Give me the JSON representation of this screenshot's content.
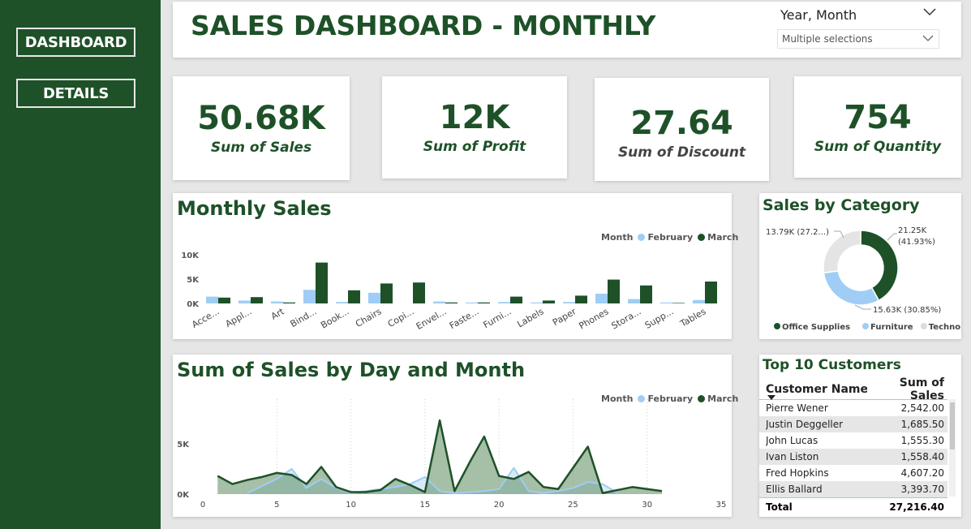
{
  "nav": {
    "dashboard": "DASHBOARD",
    "details": "DETAILS"
  },
  "header": {
    "title": "SALES DASHBOARD - MONTHLY",
    "slicer_label": "Year, Month",
    "slicer_value": "Multiple selections"
  },
  "kpis": [
    {
      "value": "50.68K",
      "label": "Sum of Sales"
    },
    {
      "value": "12K",
      "label": "Sum of Profit"
    },
    {
      "value": "27.64",
      "label": "Sum of Discount"
    },
    {
      "value": "754",
      "label": "Sum of Quantity"
    }
  ],
  "colors": {
    "brand": "#1e5128",
    "february": "#9fcdf5",
    "march": "#1e5128",
    "technology": "#e4e4e4"
  },
  "table": {
    "title": "Top 10 Customers",
    "headers": [
      "Customer Name",
      "Sum of Sales"
    ],
    "rows": [
      [
        "Pierre Wener",
        "2,542.00"
      ],
      [
        "Justin Deggeller",
        "1,685.50"
      ],
      [
        "John Lucas",
        "1,555.30"
      ],
      [
        "Ivan Liston",
        "1,558.40"
      ],
      [
        "Fred Hopkins",
        "4,607.20"
      ],
      [
        "Ellis Ballard",
        "3,393.70"
      ]
    ],
    "total_label": "Total",
    "total_value": "27,216.40"
  },
  "chart_data": [
    {
      "type": "bar",
      "title": "Monthly Sales",
      "legend_title": "Month",
      "categories": [
        "Acce...",
        "Appl...",
        "Art",
        "Bind...",
        "Book...",
        "Chairs",
        "Copi...",
        "Envel...",
        "Faste...",
        "Furni...",
        "Labels",
        "Paper",
        "Phones",
        "Stora...",
        "Supp...",
        "Tables"
      ],
      "series": [
        {
          "name": "February",
          "values": [
            1400,
            600,
            400,
            2800,
            300,
            2200,
            0,
            400,
            200,
            300,
            200,
            300,
            2000,
            900,
            200,
            700
          ]
        },
        {
          "name": "March",
          "values": [
            1200,
            1300,
            200,
            8400,
            2700,
            4100,
            4300,
            200,
            200,
            1400,
            600,
            1600,
            4900,
            3700,
            100,
            4500
          ]
        }
      ],
      "yticks": [
        "10K",
        "5K",
        "0K"
      ],
      "ylim": [
        0,
        10000
      ],
      "legend": "top-right"
    },
    {
      "type": "pie",
      "title": "Sales by Category",
      "labels": [
        "Office Supplies",
        "Furniture",
        "Technology"
      ],
      "values": [
        21.25,
        15.63,
        13.79
      ],
      "data_labels": [
        "21.25K (41.93%)",
        "15.63K (30.85%)",
        "13.79K (27.2...)"
      ],
      "legend": "bottom"
    },
    {
      "type": "area",
      "title": "Sum of Sales by Day and Month",
      "legend_title": "Month",
      "series": [
        {
          "name": "February",
          "x": [
            3,
            5,
            6,
            7,
            8,
            9,
            10,
            11,
            12,
            13,
            14,
            15,
            16,
            17,
            18,
            19,
            20,
            21,
            22,
            23,
            24,
            25,
            26,
            27,
            28
          ],
          "values": [
            100,
            1500,
            2500,
            600,
            1500,
            600,
            100,
            300,
            500,
            700,
            1000,
            1700,
            300,
            100,
            200,
            300,
            500,
            2600,
            300,
            100,
            300,
            600,
            1200,
            1000,
            100
          ]
        },
        {
          "name": "March",
          "x": [
            1,
            2,
            3,
            4,
            5,
            6,
            7,
            8,
            9,
            10,
            11,
            12,
            13,
            14,
            15,
            16,
            17,
            18,
            19,
            20,
            21,
            22,
            23,
            24,
            25,
            26,
            27,
            28,
            29,
            30,
            31
          ],
          "values": [
            1800,
            1000,
            1400,
            1700,
            2100,
            1900,
            1000,
            2700,
            700,
            200,
            200,
            400,
            1500,
            900,
            200,
            7300,
            300,
            3100,
            5700,
            1800,
            1500,
            2200,
            700,
            500,
            2600,
            4700,
            100,
            400,
            700,
            500,
            300
          ]
        }
      ],
      "xticks": [
        0,
        5,
        10,
        15,
        20,
        25,
        30,
        35
      ],
      "yticks": [
        "5K",
        "0K"
      ],
      "xlim": [
        0,
        35
      ],
      "ylim": [
        0,
        9000
      ],
      "legend": "top-right"
    }
  ]
}
